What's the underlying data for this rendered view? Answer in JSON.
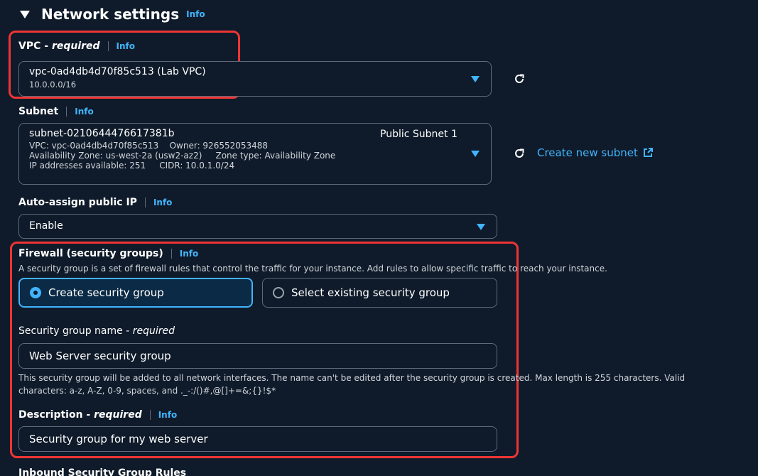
{
  "section": {
    "title": "Network settings",
    "info": "Info"
  },
  "vpc": {
    "label": "VPC -",
    "required": "required",
    "info": "Info",
    "value": "vpc-0ad4db4d70f85c513 (Lab VPC)",
    "cidr": "10.0.0.0/16"
  },
  "subnet": {
    "label": "Subnet",
    "info": "Info",
    "id": "subnet-0210644476617381b",
    "name": "Public Subnet 1",
    "line_vpc": "VPC: vpc-0ad4db4d70f85c513",
    "line_owner": "Owner: 926552053488",
    "line_az": "Availability Zone: us-west-2a (usw2-az2)",
    "line_zone": "Zone type: Availability Zone",
    "line_ips": "IP addresses available: 251",
    "line_cidr": "CIDR: 10.0.1.0/24",
    "create_link": "Create new subnet"
  },
  "auto_ip": {
    "label": "Auto-assign public IP",
    "info": "Info",
    "value": "Enable"
  },
  "firewall": {
    "label": "Firewall (security groups)",
    "info": "Info",
    "description": "A security group is a set of firewall rules that control the traffic for your instance. Add rules to allow specific traffic to reach your instance.",
    "option_create": "Create security group",
    "option_select": "Select existing security group"
  },
  "sg_name": {
    "label": "Security group name -",
    "required": "required",
    "value": "Web Server security group",
    "help1": "This security group will be added to all network interfaces. The name can't be edited after the security group is created. Max length is 255 characters. Valid",
    "help2": "characters: a-z, A-Z, 0-9, spaces, and ._-:/()#,@[]+=&;{}!$*"
  },
  "desc": {
    "label": "Description -",
    "required": "required",
    "info": "Info",
    "value": "Security group for my web server"
  },
  "inbound": {
    "label": "Inbound Security Group Rules"
  },
  "colors": {
    "background": "#0f1b2a",
    "accent": "#42b4ff",
    "highlight": "#ee3535"
  },
  "icons": [
    "caret-down-icon",
    "dropdown-arrow-icon",
    "refresh-icon",
    "external-link-icon",
    "radio-selected-icon",
    "radio-unselected-icon"
  ]
}
